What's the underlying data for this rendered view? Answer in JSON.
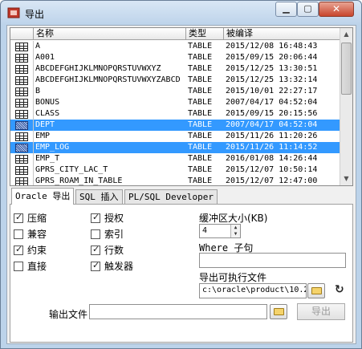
{
  "window": {
    "title": "导出"
  },
  "grid": {
    "columns": [
      "名称",
      "类型",
      "被编译"
    ],
    "rows": [
      {
        "name": "A",
        "type": "TABLE",
        "compiled": "2015/12/08 16:48:43",
        "selected": false
      },
      {
        "name": "A001",
        "type": "TABLE",
        "compiled": "2015/09/15 20:06:44",
        "selected": false
      },
      {
        "name": "ABCDEFGHIJKLMNOPQRSTUVWXYZ",
        "type": "TABLE",
        "compiled": "2015/12/25 13:30:51",
        "selected": false
      },
      {
        "name": "ABCDEFGHIJKLMNOPQRSTUVWXYZABCD",
        "type": "TABLE",
        "compiled": "2015/12/25 13:32:14",
        "selected": false
      },
      {
        "name": "B",
        "type": "TABLE",
        "compiled": "2015/10/01 22:27:17",
        "selected": false
      },
      {
        "name": "BONUS",
        "type": "TABLE",
        "compiled": "2007/04/17 04:52:04",
        "selected": false
      },
      {
        "name": "CLASS",
        "type": "TABLE",
        "compiled": "2015/09/15 20:15:56",
        "selected": false
      },
      {
        "name": "DEPT",
        "type": "TABLE",
        "compiled": "2007/04/17 04:52:04",
        "selected": true
      },
      {
        "name": "EMP",
        "type": "TABLE",
        "compiled": "2015/11/26 11:20:26",
        "selected": false
      },
      {
        "name": "EMP_LOG",
        "type": "TABLE",
        "compiled": "2015/11/26 11:14:52",
        "selected": true
      },
      {
        "name": "EMP_T",
        "type": "TABLE",
        "compiled": "2016/01/08 14:26:44",
        "selected": false
      },
      {
        "name": "GPRS_CITY_LAC_T",
        "type": "TABLE",
        "compiled": "2015/12/07 10:50:14",
        "selected": false
      },
      {
        "name": "GPRS_ROAM_IN_TABLE",
        "type": "TABLE",
        "compiled": "2015/12/07 12:47:00",
        "selected": false
      }
    ]
  },
  "tabs": [
    "Oracle 导出",
    "SQL 插入",
    "PL/SQL Developer"
  ],
  "options": {
    "compress": {
      "label": "压缩",
      "checked": true
    },
    "compatible": {
      "label": "兼容",
      "checked": false
    },
    "constraints": {
      "label": "约束",
      "checked": true
    },
    "direct": {
      "label": "直接",
      "checked": false
    },
    "grants": {
      "label": "授权",
      "checked": true
    },
    "indexes": {
      "label": "索引",
      "checked": false
    },
    "rows": {
      "label": "行数",
      "checked": true
    },
    "triggers": {
      "label": "触发器",
      "checked": true
    }
  },
  "buffer": {
    "label": "缓冲区大小(KB)",
    "value": "4"
  },
  "where": {
    "label": "Where 子句",
    "value": ""
  },
  "executable": {
    "label": "导出可执行文件",
    "value": "c:\\oracle\\product\\10.2"
  },
  "output": {
    "label": "输出文件",
    "value": ""
  },
  "export_button": "导出"
}
